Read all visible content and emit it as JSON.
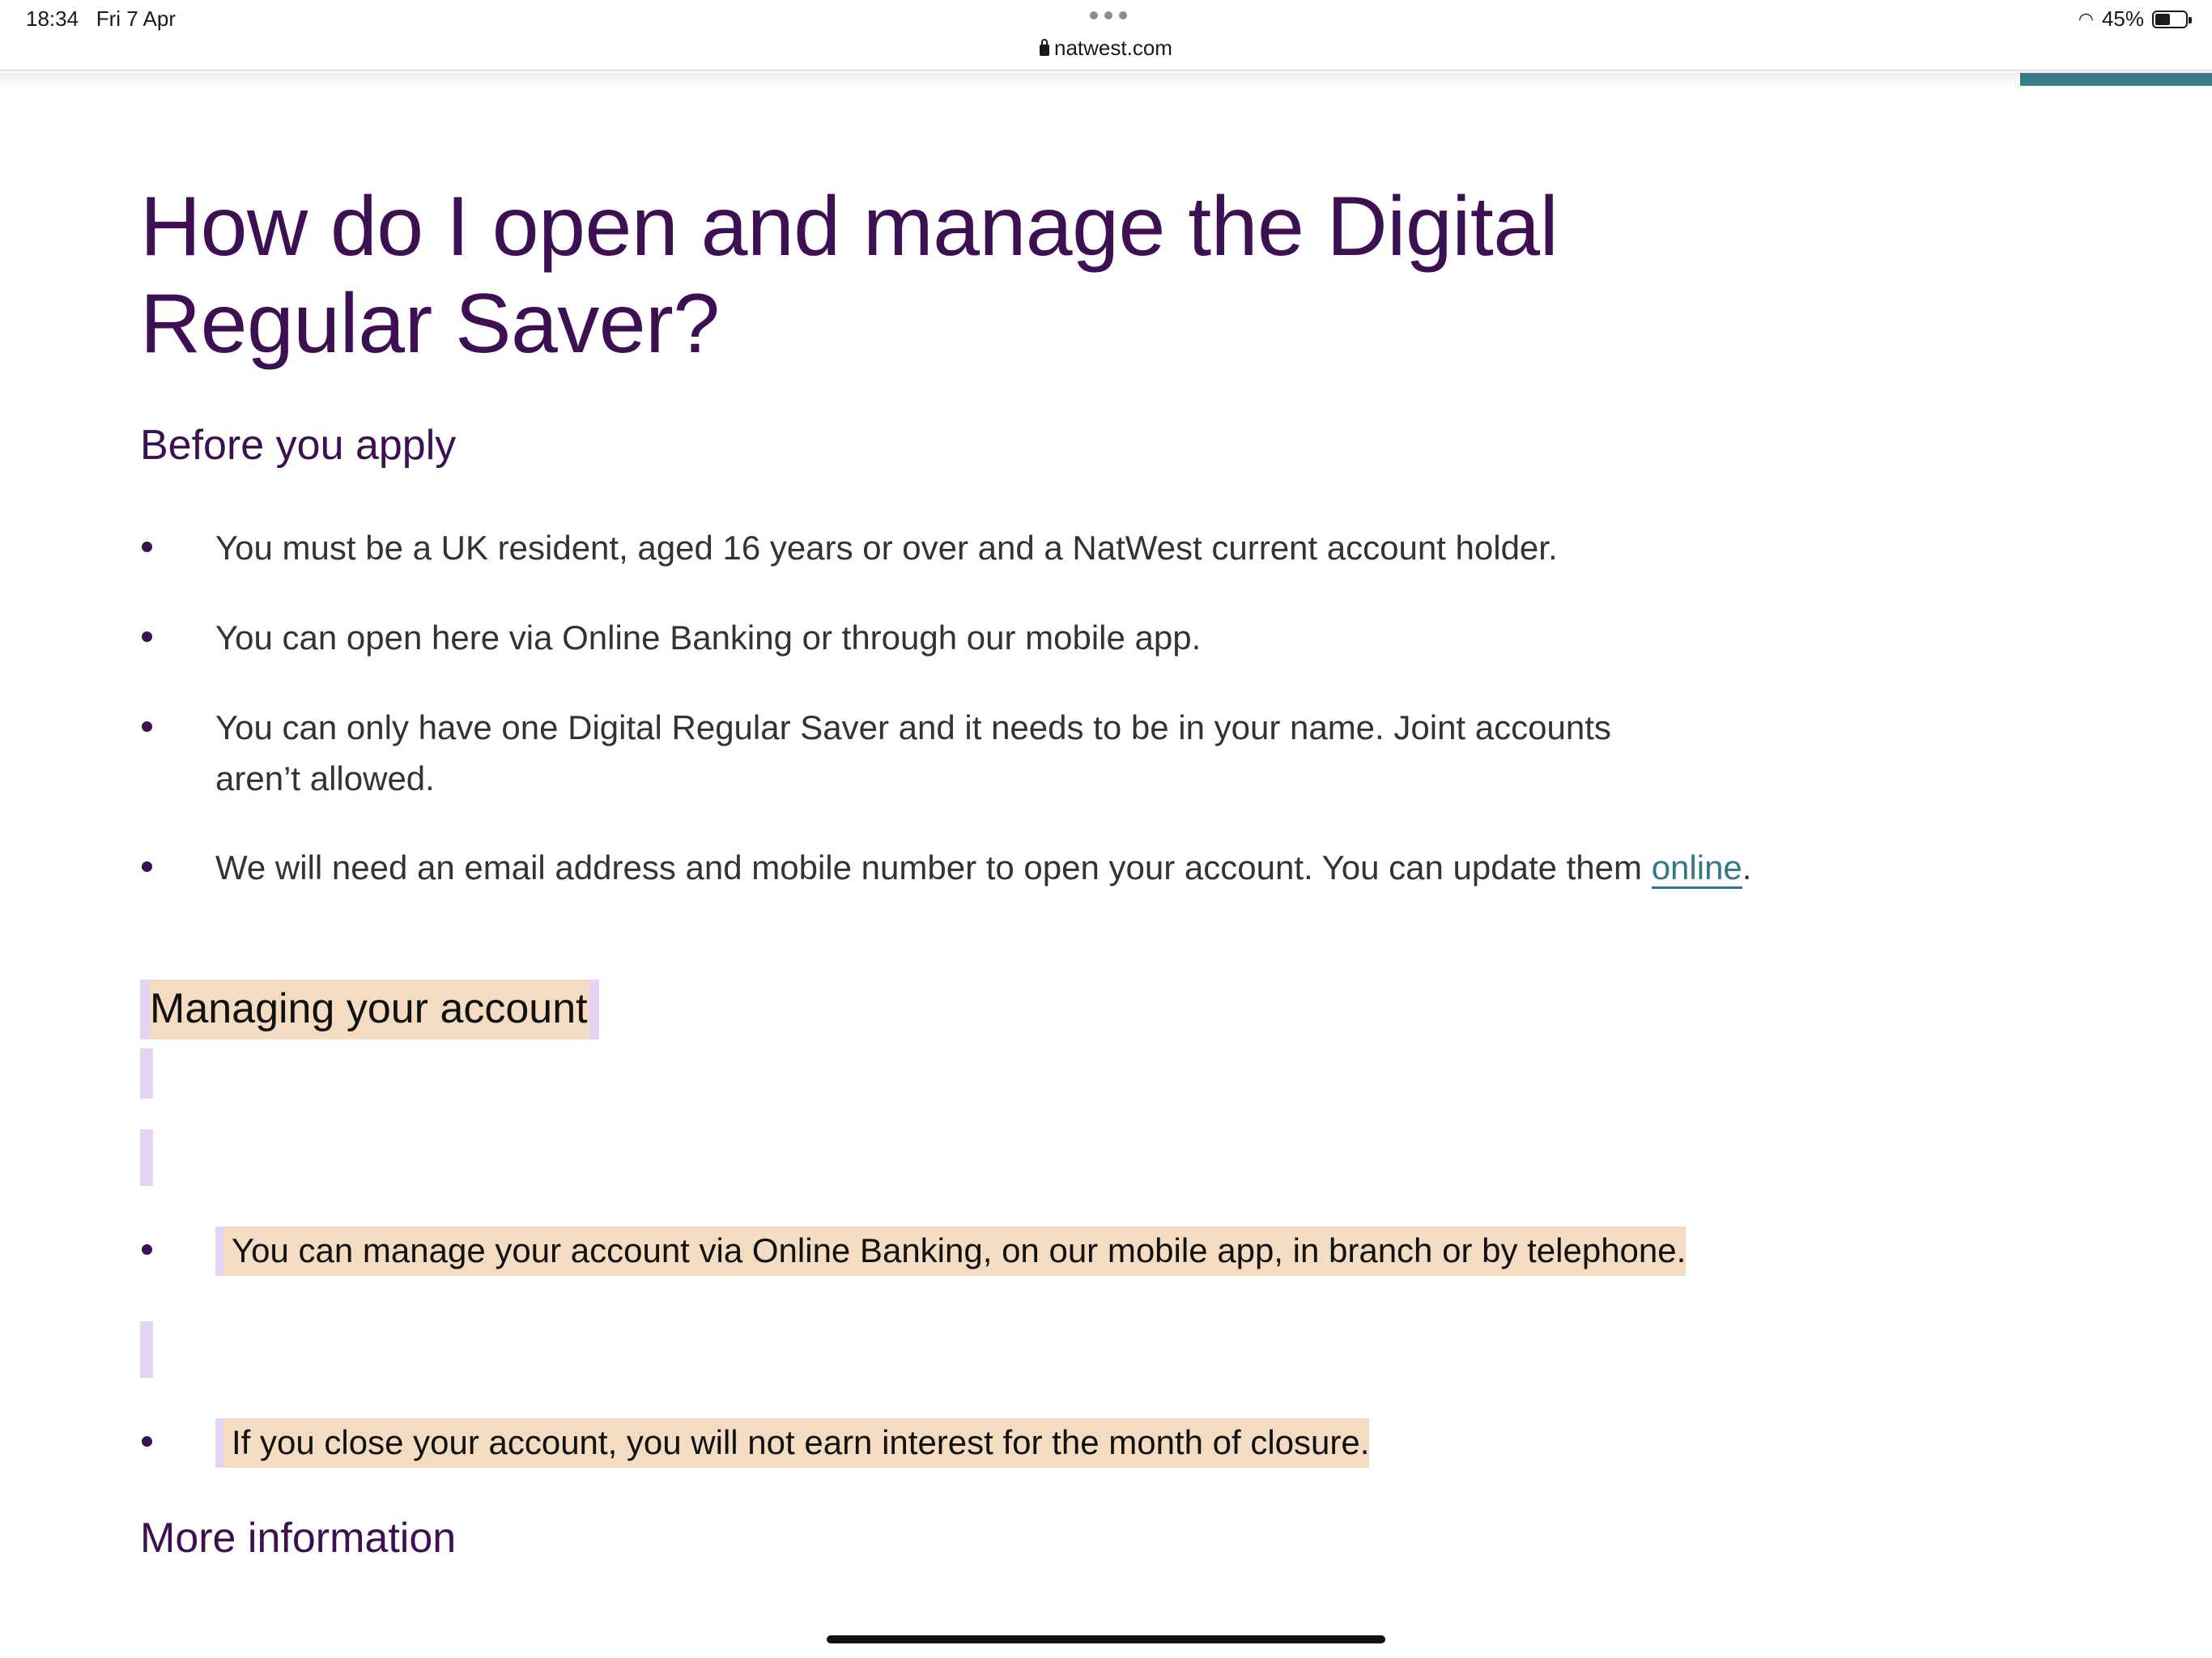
{
  "status_bar": {
    "time": "18:34",
    "date": "Fri 7 Apr",
    "battery": "45%",
    "url": "natwest.com"
  },
  "article": {
    "title": "How do I open and manage the Digital Regular Saver?",
    "before_heading": "Before you apply",
    "before_items": [
      "You must be a UK resident, aged 16 years or over and a NatWest current account holder.",
      "You can open here via Online Banking or through our mobile app.",
      "You can only have one Digital Regular Saver and it needs to be in your name. Joint accounts aren’t allowed."
    ],
    "email_item_prefix": "We will need an email address and mobile number to open your account. You can update them ",
    "email_item_link": "online",
    "email_item_suffix": ".",
    "managing_heading": "Managing your account",
    "managing_items": [
      "You can manage your account via Online Banking, on our mobile app, in branch or by telephone.",
      "If you close your account, you will not earn interest for the month of closure."
    ],
    "more_heading": "More information"
  },
  "colors": {
    "heading_purple": "#3c1053",
    "link_teal": "#2f7a86",
    "highlight_peach": "#f3dcc2",
    "highlight_lilac": "#e3d2f1"
  }
}
